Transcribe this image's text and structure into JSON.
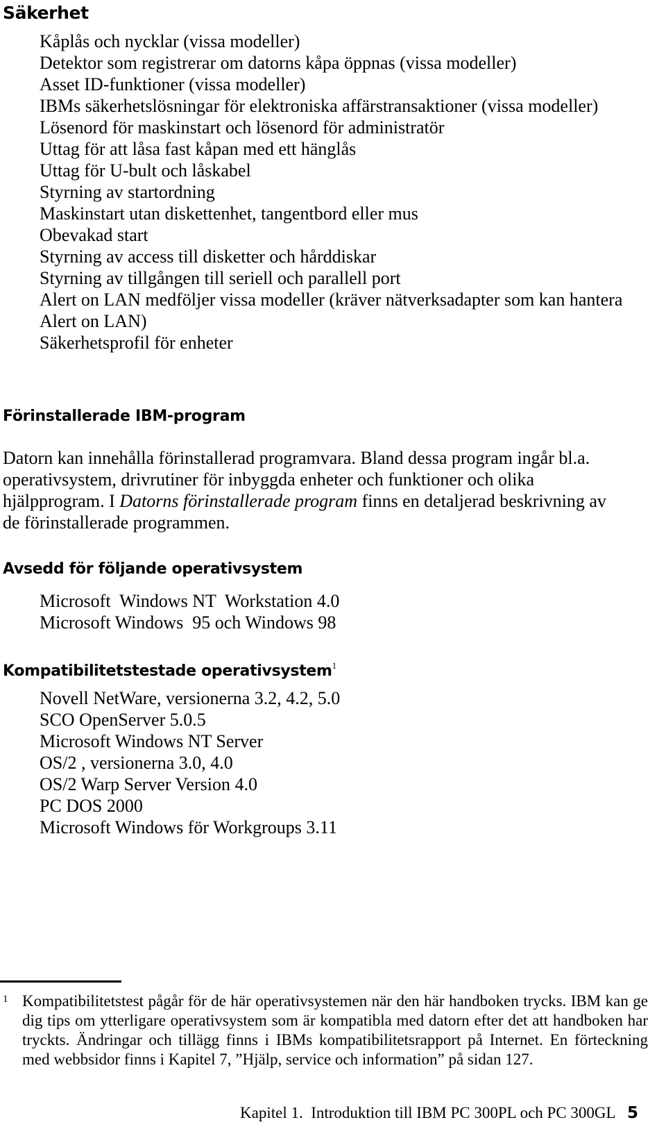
{
  "document": {
    "language": "sv",
    "page_number": "5"
  },
  "sections": {
    "security": {
      "heading": "Säkerhet",
      "items": [
        "Kåplås och nycklar (vissa modeller)",
        "Detektor som registrerar om datorns kåpa öppnas (vissa modeller)",
        "Asset ID-funktioner (vissa modeller)",
        "IBMs säkerhetslösningar för elektroniska affärstransaktioner (vissa modeller)",
        "Lösenord för maskinstart och lösenord för administratör",
        "Uttag för att låsa fast kåpan med ett hänglås",
        "Uttag för U-bult och låskabel",
        "Styrning av startordning",
        "Maskinstart utan diskettenhet, tangentbord eller mus",
        "Obevakad start",
        "Styrning av access till disketter och hårddiskar",
        "Styrning av tillgången till seriell och parallell port",
        "Alert on LAN medföljer vissa modeller (kräver nätverksadapter som kan hantera Alert on LAN)",
        "Säkerhetsprofil för enheter"
      ]
    },
    "preinstalled": {
      "heading": "Förinstallerade IBM-program",
      "paragraph_part1": "Datorn kan innehålla förinstallerad programvara. Bland dessa program ingår bl.a. operativsystem, drivrutiner för inbyggda enheter och funktioner och olika hjälpprogram. I ",
      "paragraph_italic": "Datorns förinstallerade program",
      "paragraph_part2": " finns en detaljerad beskrivning av de förinstallerade programmen."
    },
    "intended_os": {
      "heading": "Avsedd för följande operativsystem",
      "items": [
        "Microsoft  Windows NT  Workstation 4.0",
        "Microsoft Windows  95 och Windows 98"
      ]
    },
    "compatible_os": {
      "heading": "Kompatibilitetstestade operativsystem",
      "footnote_ref": "1",
      "items": [
        "Novell NetWare, versionerna 3.2, 4.2, 5.0",
        "SCO OpenServer 5.0.5",
        "Microsoft Windows NT Server",
        "OS/2 , versionerna 3.0, 4.0",
        "OS/2 Warp Server Version 4.0",
        "PC DOS 2000",
        "Microsoft Windows för Workgroups 3.11"
      ]
    }
  },
  "footnote": {
    "marker": "1",
    "text": "Kompatibilitetstest pågår för de här operativsystemen när den här handboken trycks. IBM kan ge dig tips om ytterligare operativsystem som är kompatibla med datorn efter det att handboken har tryckts. Ändringar och tillägg finns i IBMs kompatibilitetsrapport på Internet. En förteckning med webbsidor finns i Kapitel 7, ”Hjälp, service och information” på sidan  127."
  },
  "page_footer": {
    "text": "Kapitel 1.  Introduktion till IBM PC 300PL och PC 300GL",
    "page_number": "5"
  }
}
